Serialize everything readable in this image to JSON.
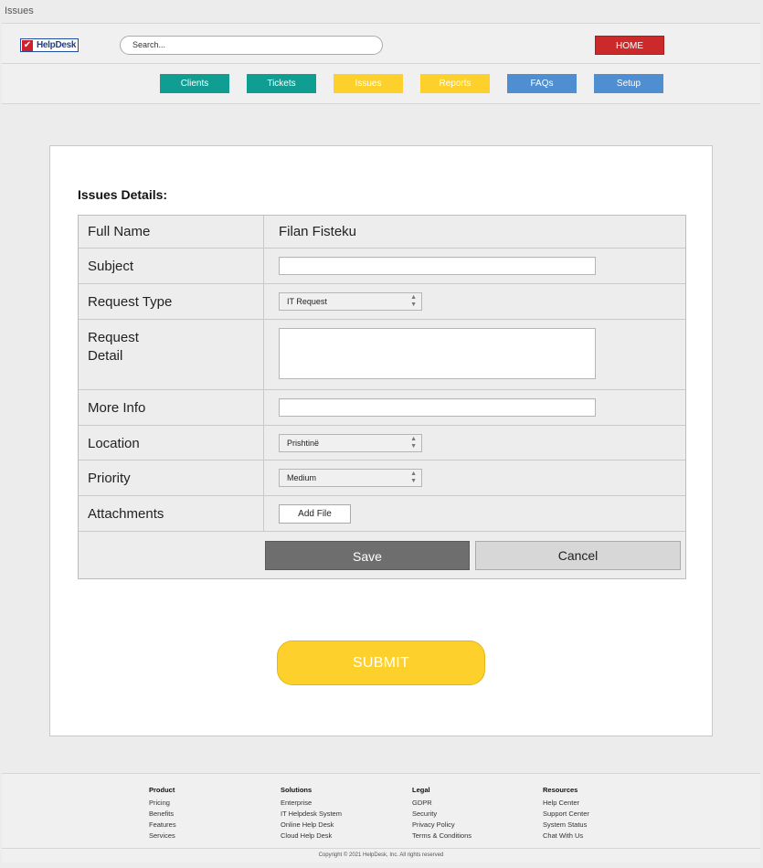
{
  "window": {
    "title": "Issues"
  },
  "header": {
    "logo_text": "HelpDesk",
    "search_placeholder": "Search...",
    "home_label": "HOME"
  },
  "nav": [
    {
      "label": "Clients",
      "color": "#109e93"
    },
    {
      "label": "Tickets",
      "color": "#109e93"
    },
    {
      "label": "Issues",
      "color": "#fdd02c"
    },
    {
      "label": "Reports",
      "color": "#fdd02c"
    },
    {
      "label": "FAQs",
      "color": "#4f8fd1"
    },
    {
      "label": "Setup",
      "color": "#4f8fd1"
    }
  ],
  "form": {
    "title": "Issues Details:",
    "full_name_label": "Full Name",
    "full_name_value": "Filan Fisteku",
    "subject_label": "Subject",
    "request_type_label": "Request Type",
    "request_type_value": "IT Request",
    "request_detail_label": "Request Detail",
    "more_info_label": "More Info",
    "location_label": "Location",
    "location_value": "Prishtinë",
    "priority_label": "Priority",
    "priority_value": "Medium",
    "attachments_label": "Attachments",
    "add_file_label": "Add File",
    "save_label": "Save",
    "cancel_label": "Cancel"
  },
  "submit_label": "SUBMIT",
  "footer": {
    "columns": [
      {
        "heading": "Product",
        "items": [
          "Pricing",
          "Benefits",
          "Features",
          "Services"
        ]
      },
      {
        "heading": "Solutions",
        "items": [
          "Enterprise",
          "IT Helpdesk System",
          "Online Help Desk",
          "Cloud Help Desk"
        ]
      },
      {
        "heading": "Legal",
        "items": [
          "GDPR",
          "Security",
          "Privacy Policy",
          "Terms & Conditions"
        ]
      },
      {
        "heading": "Resources",
        "items": [
          "Help Center",
          "Support Center",
          "System Status",
          "Chat With Us"
        ]
      }
    ],
    "copyright": "Copyright © 2021 HelpDesk, Inc. All rights reserved"
  }
}
